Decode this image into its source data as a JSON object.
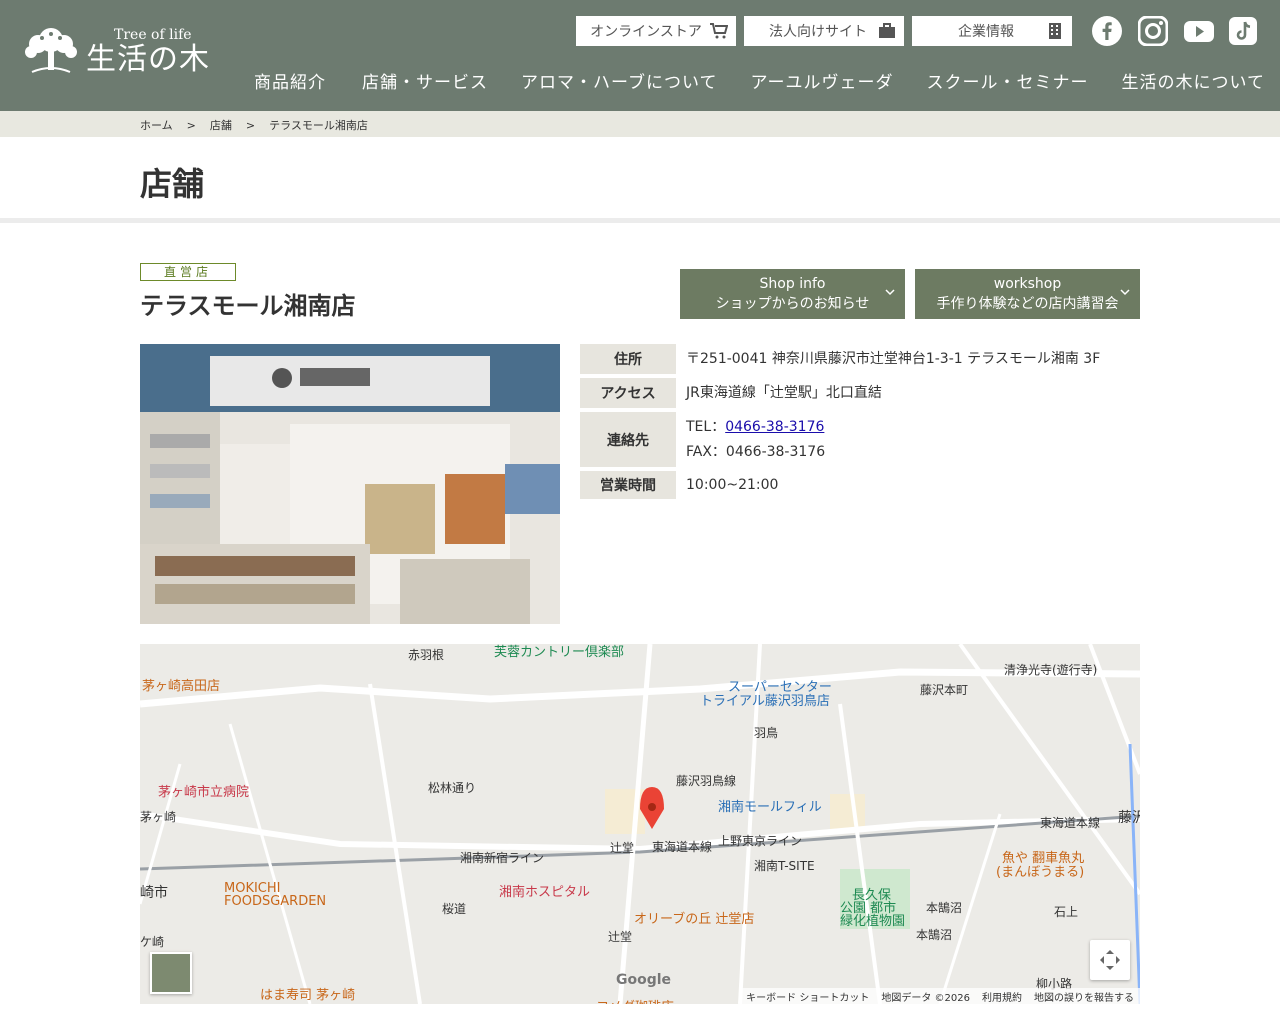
{
  "header": {
    "logo_en": "Tree of life",
    "logo_jp": "生活の木",
    "util_buttons": [
      {
        "label": "オンラインストア",
        "icon": "cart-icon"
      },
      {
        "label": "法人向けサイト",
        "icon": "briefcase-icon"
      },
      {
        "label": "企業情報",
        "icon": "building-icon"
      }
    ],
    "sns": [
      "facebook-icon",
      "instagram-icon",
      "youtube-icon",
      "tiktok-icon"
    ],
    "nav": [
      "商品紹介",
      "店舗・サービス",
      "アロマ・ハーブについて",
      "アーユルヴェーダ",
      "スクール・セミナー",
      "生活の木について"
    ]
  },
  "breadcrumb": {
    "items": [
      "ホーム",
      "店舗",
      "テラスモール湘南店"
    ],
    "separator": ">"
  },
  "page": {
    "title": "店舗"
  },
  "shop": {
    "badge": "直営店",
    "name": "テラスモール湘南店",
    "buttons": [
      {
        "line1": "Shop info",
        "line2": "ショップからのお知らせ"
      },
      {
        "line1": "workshop",
        "line2": "手作り体験などの店内講習会"
      }
    ],
    "info": {
      "address_label": "住所",
      "address": "〒251-0041 神奈川県藤沢市辻堂神台1-3-1 テラスモール湘南 3F",
      "access_label": "アクセス",
      "access": "JR東海道線「辻堂駅」北口直結",
      "contact_label": "連絡先",
      "tel_prefix": "TEL：",
      "tel": "0466-38-3176",
      "fax": "FAX：0466-38-3176",
      "hours_label": "営業時間",
      "hours": "10:00~21:00"
    }
  },
  "map": {
    "labels": {
      "akabane": "赤羽根",
      "country": "芙蓉カントリー倶楽部",
      "takada": "茅ヶ崎高田店",
      "super": "スーパーセンター",
      "trial": "トライアル藤沢羽鳥店",
      "shojoko": "清浄光寺(遊行寺)",
      "fujisawahoncho": "藤沢本町",
      "hatori": "羽鳥",
      "hospital": "茅ヶ崎市立病院",
      "shorin": "松林通り",
      "hatorisen": "藤沢羽鳥線",
      "moolfill": "湘南モールフィル",
      "chigasaki": "茅ヶ崎",
      "tsujido": "辻堂",
      "tokaido": "東海道本線",
      "ueno": "上野東京ライン",
      "shinjuku": "湘南新宿ライン",
      "tokaidohonsen": "東海道本線",
      "fujisawa": "藤沢",
      "tsite": "湘南T-SITE",
      "uoya": "魚や 翻車魚丸",
      "uoya2": "(まんぼうまる)",
      "chigasakishi": "崎市",
      "mokichi": "MOKICHI",
      "foods": "FOODSGARDEN",
      "shonanhosp": "湘南ホスピタル",
      "olive": "オリーブの丘 辻堂店",
      "nagakubo": "長久保",
      "nagakubo2": "公園 都市",
      "nagakubo3": "緑化植物園",
      "sakuramichi": "桜道",
      "kugenuma": "本鵠沼",
      "kugenuma2": "本鵠沼",
      "ishigami": "石上",
      "tsujido2": "辻堂",
      "kesaki": "ケ崎",
      "yanagikoji": "柳小路",
      "hamazushi": "はま寿司 茅ヶ崎",
      "komeda": "コメダ珈琲店",
      "google": "Google"
    },
    "footer": [
      "キーボード ショートカット",
      "地図データ ©2026",
      "利用規約",
      "地図の誤りを報告する"
    ]
  }
}
